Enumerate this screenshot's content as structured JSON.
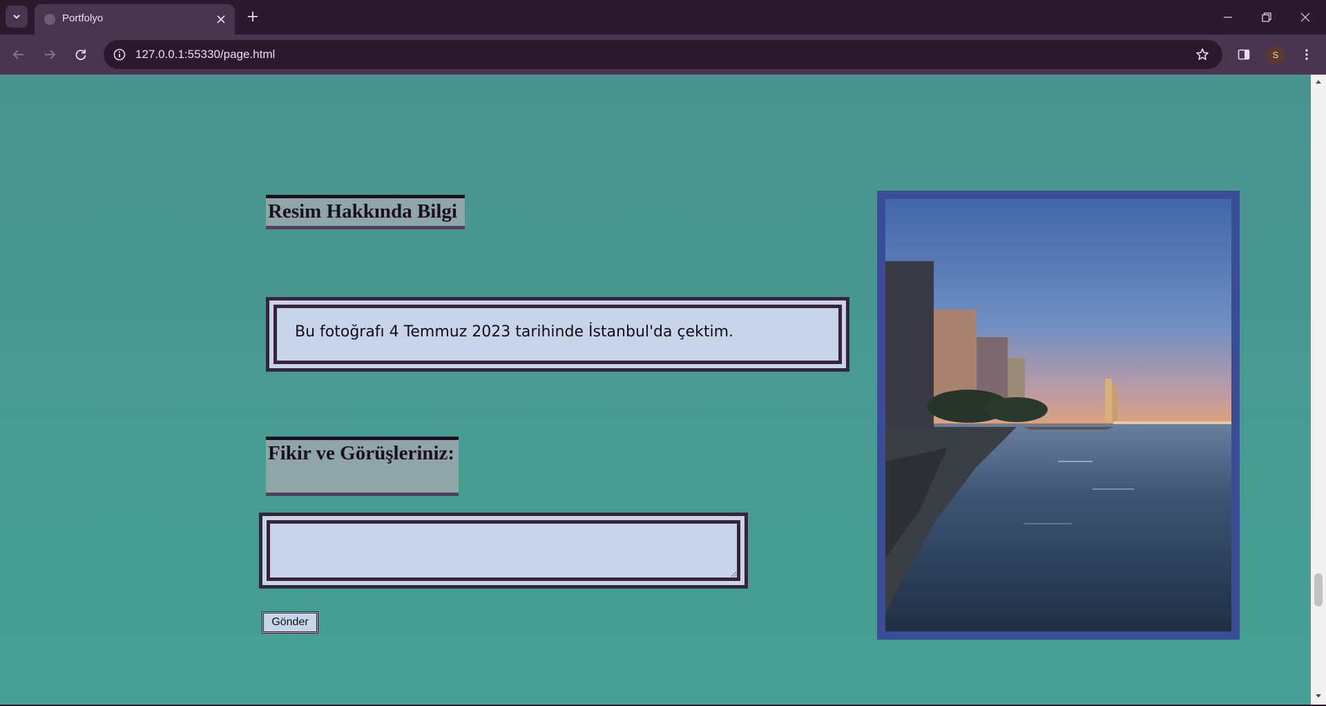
{
  "browser": {
    "tab_title": "Portfolyo",
    "url": "127.0.0.1:55330/page.html",
    "profile_initial": "S"
  },
  "page": {
    "info_heading": "Resim Hakkında Bilgi",
    "info_text": "Bu fotoğrafı 4 Temmuz 2023 tarihinde İstanbul'da çektim.",
    "comment_heading": "Fikir ve Görüşleriniz:",
    "comment_value": "",
    "submit_label": "Gönder"
  },
  "colors": {
    "page_background": "#4a9490",
    "box_fill": "#c7d4ea",
    "box_border": "#35243a",
    "heading_fill": "#8fa6a8",
    "photo_frame": "#3a4e96",
    "chrome_dark": "#2b1a2e",
    "chrome_light": "#4a3550"
  },
  "icons": {
    "tab_list": "chevron-down-icon",
    "favicon": "globe-icon",
    "tab_close": "close-icon",
    "new_tab": "plus-icon",
    "back": "arrow-left-icon",
    "forward": "arrow-right-icon",
    "reload": "reload-icon",
    "site_info": "info-icon",
    "bookmark": "star-icon",
    "side_panel": "side-panel-icon",
    "menu": "kebab-menu-icon"
  }
}
